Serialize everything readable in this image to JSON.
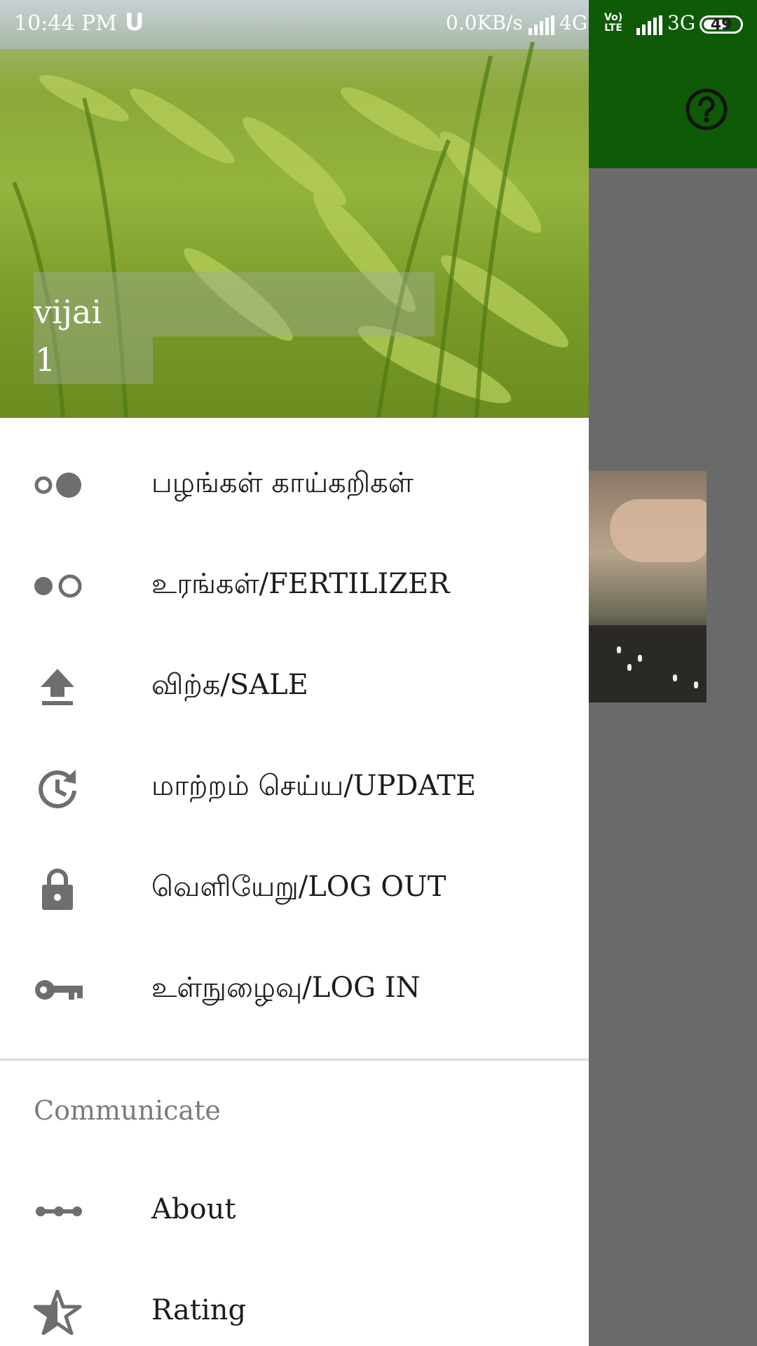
{
  "status_bar": {
    "time": "10:44 PM",
    "carrier_icon": "U",
    "speed": "0.0KB/s",
    "network1": "4G",
    "volte_top": "Vo)",
    "volte_bottom": "LTE",
    "network2": "3G",
    "battery": "49"
  },
  "profile": {
    "name": "vijai",
    "id": "1"
  },
  "menu": {
    "items": [
      {
        "label": "பழங்கள் காய்கறிகள்",
        "icon": "toggle-off-icon"
      },
      {
        "label": "உரங்கள்/FERTILIZER",
        "icon": "toggle-on-icon"
      },
      {
        "label": "விற்க/SALE",
        "icon": "upload-icon"
      },
      {
        "label": "மாற்றம் செய்ய/UPDATE",
        "icon": "update-clock-icon"
      },
      {
        "label": "வெளியேறு/LOG OUT",
        "icon": "lock-icon"
      },
      {
        "label": "உள்நுழைவு/LOG IN",
        "icon": "key-icon"
      }
    ],
    "section_title": "Communicate",
    "communicate_items": [
      {
        "label": "About",
        "icon": "timeline-icon"
      },
      {
        "label": "Rating",
        "icon": "star-icon"
      }
    ]
  },
  "colors": {
    "toolbar": "#0e5a06",
    "scrim": "#6a6a6a",
    "icon": "#6e6e6e"
  }
}
